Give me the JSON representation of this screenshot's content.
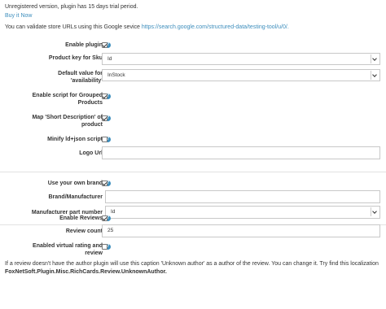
{
  "notice": "Unregistered version, plugin has 15 days trial period.",
  "buy_link": "Buy it Now",
  "validate_text": "You can validate store URLs using this Google sevice",
  "validate_link": "https://search.google.com/structured-data/testing-tool/u/0/.",
  "help_glyph": "?",
  "fields": {
    "enable_plugin": {
      "label": "Enable plugin",
      "checked": true
    },
    "product_key": {
      "label": "Product key for Sku",
      "value": "Id"
    },
    "default_availability": {
      "label_line1": "Default value for",
      "label_line2": "'availability'",
      "value": "InStock"
    },
    "enable_grouped": {
      "label_line1": "Enable script for Grouped",
      "label_line2": "Products",
      "checked": true
    },
    "map_short_desc": {
      "label_line1": "Map 'Short Description' of",
      "label_line2": "product",
      "checked": true
    },
    "minify": {
      "label": "Minify ld+json script",
      "checked": false
    },
    "logo_url": {
      "label": "Logo Url",
      "value": ""
    },
    "own_brand": {
      "label": "Use your own brand",
      "checked": true
    },
    "brand_manufacturer": {
      "label": "Brand/Manufacturer",
      "value": ""
    },
    "manufacturer_part": {
      "label": "Manufacturer part number",
      "value": "Id"
    },
    "enable_reviews": {
      "label": "Enable Reviews",
      "checked": true
    },
    "review_count": {
      "label": "Review count",
      "value": "25"
    },
    "virtual_rating": {
      "label_line1": "Enabled virtual rating and",
      "label_line2": "review",
      "checked": false
    }
  },
  "footer_text": "If a review doesn't have the author plugin will use this caption 'Unknown author' as a author of the review. You can change it. Try find this localization",
  "footer_key": "FoxNetSoft.Plugin.Misc.RichCards.Review.UnknownAuthor."
}
